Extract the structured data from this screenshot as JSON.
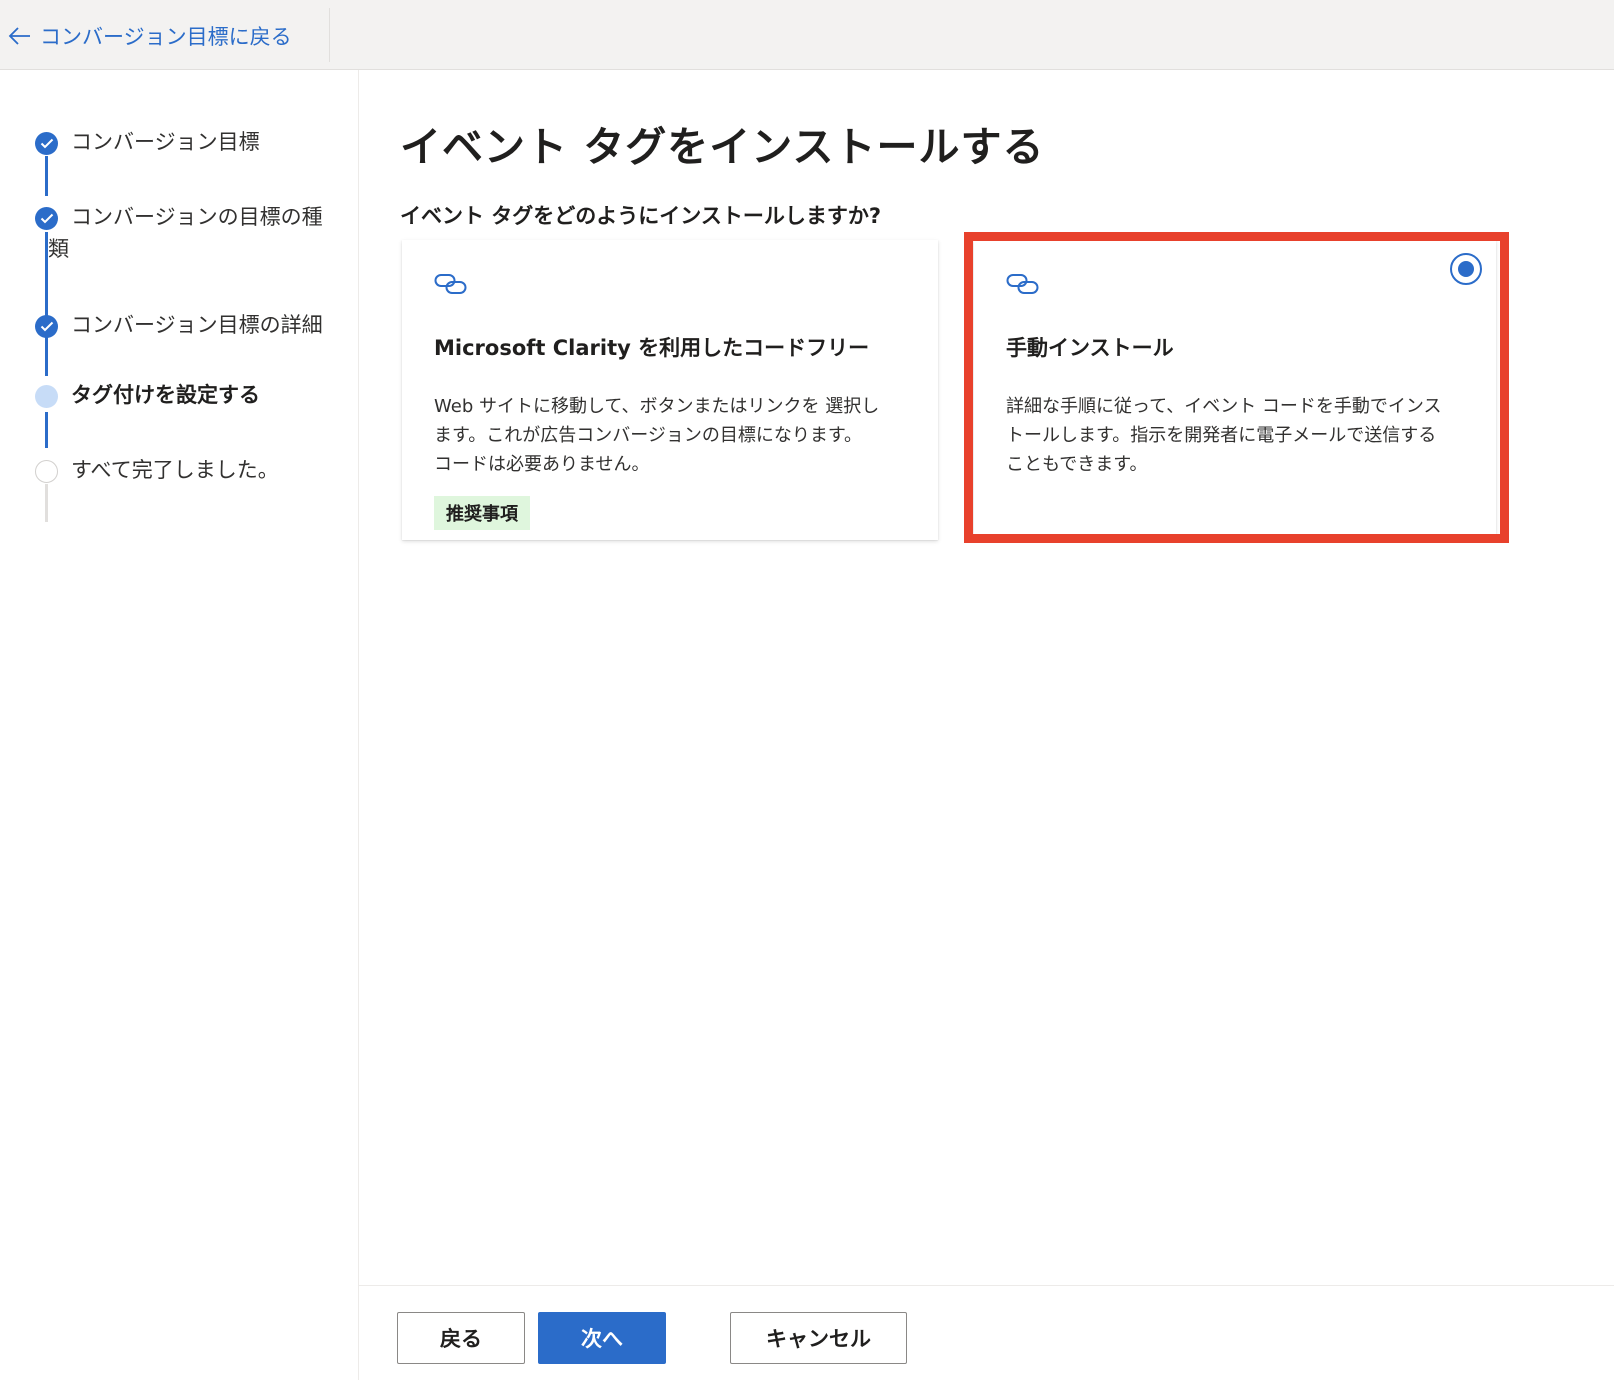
{
  "topbar": {
    "back_label": "コンバージョン目標に戻る"
  },
  "sidebar": {
    "steps": [
      {
        "label": "コンバージョン目標",
        "state": "done"
      },
      {
        "label": "コンバージョンの目標の種",
        "label_cont": "類",
        "state": "done"
      },
      {
        "label": "コンバージョン目標の詳細",
        "state": "done"
      },
      {
        "label": "タグ付けを設定する",
        "state": "current"
      },
      {
        "label": "すべて完了しました。",
        "state": "todo"
      }
    ]
  },
  "main": {
    "title": "イベント タグをインストールする",
    "question": "イベント タグをどのようにインストールしますか?",
    "options": [
      {
        "title": "Microsoft Clarity を利用したコードフリー",
        "desc_lines": [
          "Web サイトに移動して、ボタンまたはリンクを 選択し",
          "ます。これが広告コンバージョンの目標になります。",
          "コードは必要ありません。"
        ],
        "badge": "推奨事項",
        "selected": false
      },
      {
        "title": "手動インストール",
        "desc_lines": [
          "詳細な手順に従って、イベント コードを手動でインス",
          "トールします。指示を開発者に電子メールで送信する",
          "こともできます。"
        ],
        "selected": true
      }
    ]
  },
  "footer": {
    "back_label": "戻る",
    "next_label": "次へ",
    "cancel_label": "キャンセル"
  },
  "colors": {
    "accent": "#2b6cc9",
    "highlight": "#e8412c",
    "badge_bg": "#dff6dd"
  }
}
